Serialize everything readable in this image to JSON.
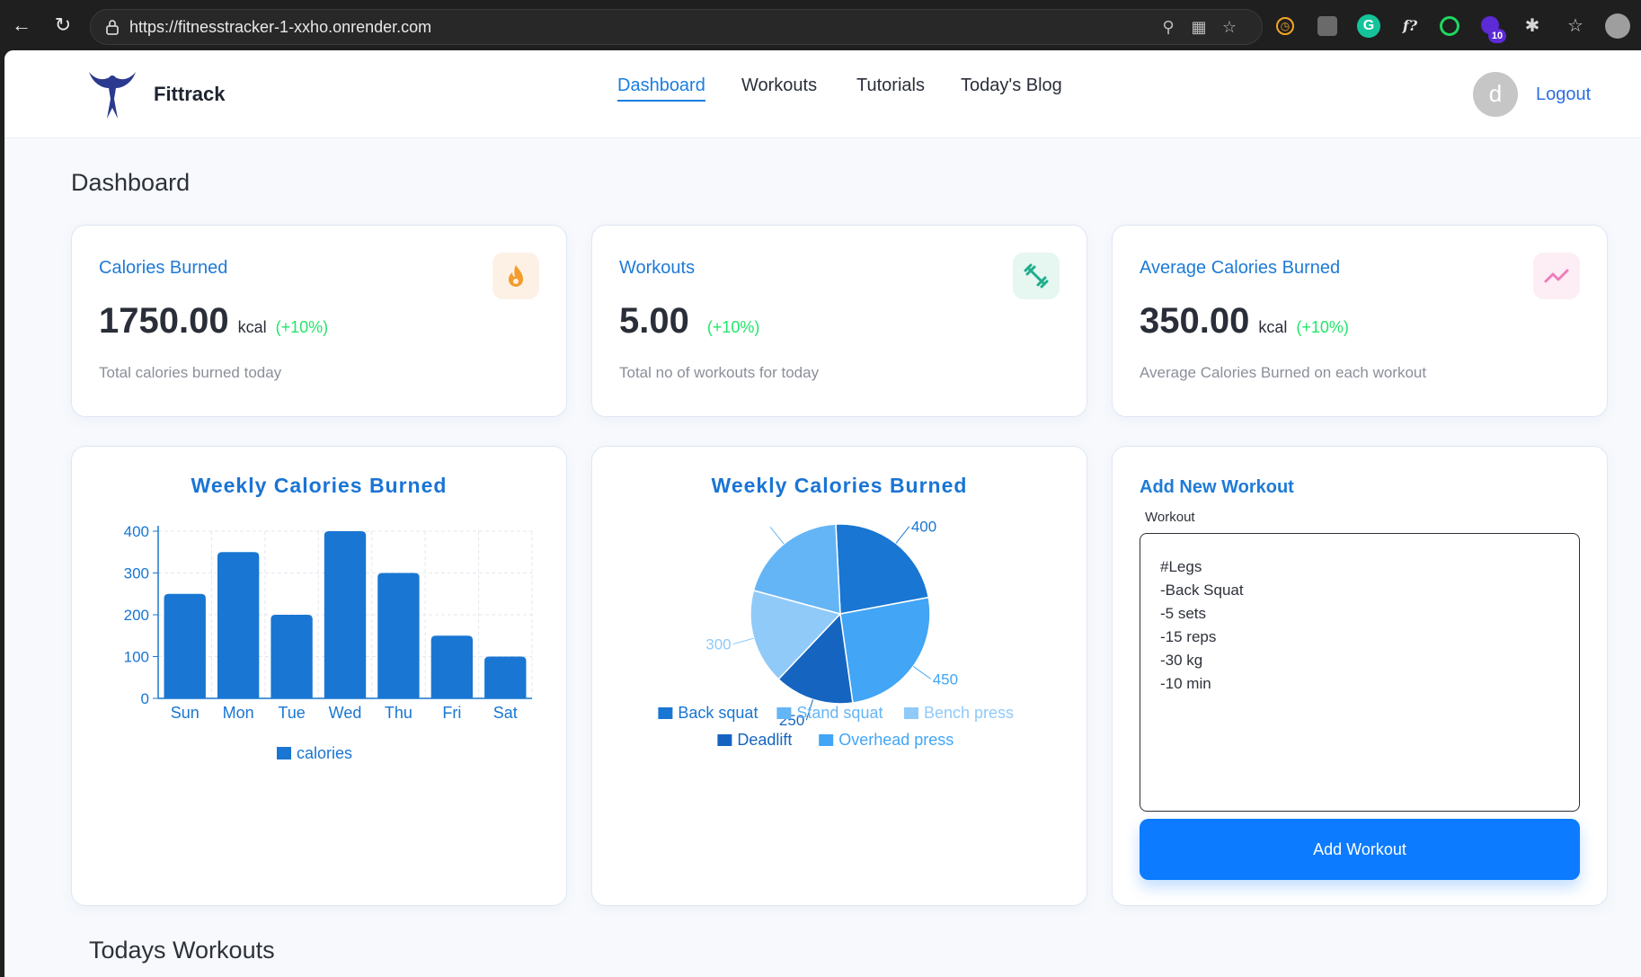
{
  "browser": {
    "url": "https://fitnesstracker-1-xxho.onrender.com",
    "extension_badge": "10"
  },
  "navbar": {
    "brand": "Fittrack",
    "links": [
      "Dashboard",
      "Workouts",
      "Tutorials",
      "Today's Blog"
    ],
    "active_link": "Dashboard",
    "avatar_letter": "d",
    "logout": "Logout"
  },
  "page_title": "Dashboard",
  "stats": [
    {
      "title": "Calories Burned",
      "value": "1750.00",
      "unit": "kcal",
      "change": "(+10%)",
      "description": "Total calories burned today",
      "icon": "fire-icon",
      "icon_bg": "#fdf1e6",
      "icon_color": "#f39c2b"
    },
    {
      "title": "Workouts",
      "value": "5.00",
      "unit": "",
      "change": "(+10%)",
      "description": "Total no of workouts for today",
      "icon": "dumbbell-icon",
      "icon_bg": "#e6f6f1",
      "icon_color": "#1fae8a"
    },
    {
      "title": "Average Calories Burned",
      "value": "350.00",
      "unit": "kcal",
      "change": "(+10%)",
      "description": "Average Calories Burned on each workout",
      "icon": "trending-icon",
      "icon_bg": "#fdeef5",
      "icon_color": "#f07cbc"
    }
  ],
  "chart_data": [
    {
      "type": "bar",
      "title": "Weekly Calories Burned",
      "categories": [
        "Sun",
        "Mon",
        "Tue",
        "Wed",
        "Thu",
        "Fri",
        "Sat"
      ],
      "series": [
        {
          "name": "calories",
          "values": [
            250,
            350,
            200,
            400,
            300,
            150,
            100
          ]
        }
      ],
      "yticks": [
        0,
        100,
        200,
        300,
        400
      ],
      "ylim": [
        0,
        400
      ],
      "grid": true,
      "legend": "bottom",
      "color": "#1976d2"
    },
    {
      "type": "pie",
      "title": "Weekly Calories Burned",
      "slices": [
        {
          "label": "Back squat",
          "value": 400,
          "color": "#1976d2",
          "value_label": "400"
        },
        {
          "label": "Overhead press",
          "value": 450,
          "color": "#42a5f5",
          "value_label": "450"
        },
        {
          "label": "Deadlift",
          "value": 250,
          "color": "#1565c0",
          "value_label": "250"
        },
        {
          "label": "Bench press",
          "value": 300,
          "color": "#90caf9",
          "value_label": "300"
        },
        {
          "label": "Stand squat",
          "value": 350,
          "color": "#64b5f6",
          "value_label": ""
        }
      ],
      "legend_order": [
        "Back squat",
        "Stand squat",
        "Bench press",
        "Deadlift",
        "Overhead press"
      ],
      "legend": "bottom"
    }
  ],
  "add_workout": {
    "title": "Add New Workout",
    "label": "Workout",
    "value": "#Legs\n-Back Squat\n-5 sets\n-15 reps\n-30 kg\n-10 min",
    "button": "Add Workout"
  },
  "section_title": "Todays Workouts"
}
